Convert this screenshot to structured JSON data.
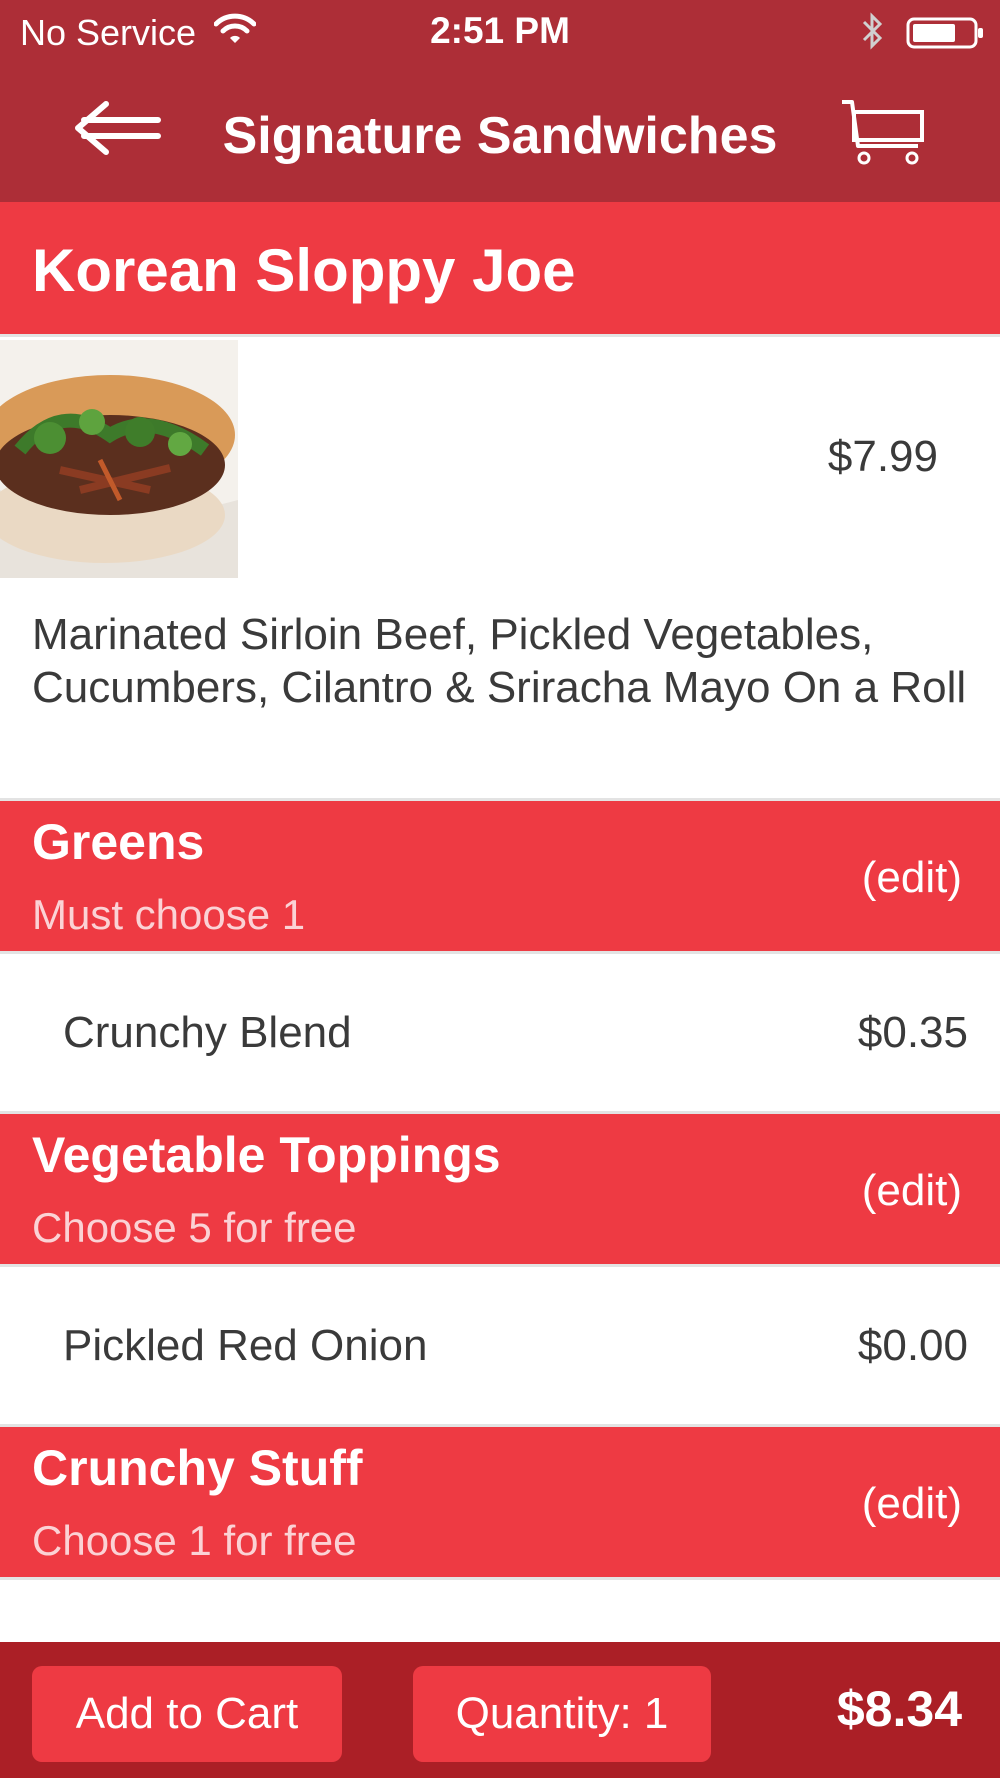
{
  "status_bar": {
    "carrier": "No Service",
    "time": "2:51 PM"
  },
  "nav": {
    "title": "Signature Sandwiches"
  },
  "product": {
    "name": "Korean Sloppy Joe",
    "price": "$7.99",
    "description": "Marinated Sirloin Beef, Pickled Vegetables, Cucumbers, Cilantro & Sriracha Mayo On a Roll"
  },
  "sections": [
    {
      "title": "Greens",
      "subtitle": "Must choose 1",
      "edit_label": "(edit)",
      "items": [
        {
          "label": "Crunchy Blend",
          "price": "$0.35"
        }
      ]
    },
    {
      "title": "Vegetable Toppings",
      "subtitle": "Choose 5 for free",
      "edit_label": "(edit)",
      "items": [
        {
          "label": "Pickled Red Onion",
          "price": "$0.00"
        }
      ]
    },
    {
      "title": "Crunchy Stuff",
      "subtitle": "Choose 1 for free",
      "edit_label": "(edit)",
      "items": []
    }
  ],
  "footer": {
    "add_to_cart_label": "Add to Cart",
    "quantity_label": "Quantity: 1",
    "total": "$8.34"
  },
  "colors": {
    "nav_red": "#ad2e37",
    "section_red": "#ee3a43",
    "footer_red": "#ab1f26",
    "text_dark": "#3a3a3a"
  },
  "icons": [
    "wifi-icon",
    "bluetooth-icon",
    "battery-icon",
    "back-arrow-icon",
    "shopping-cart-icon"
  ]
}
